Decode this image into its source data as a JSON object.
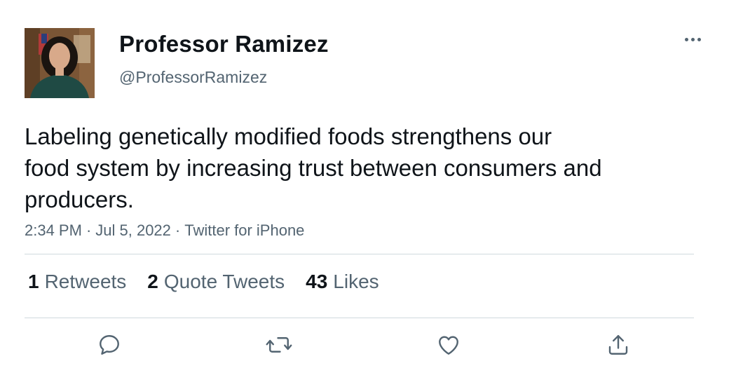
{
  "author": {
    "display_name": "Professor Ramizez",
    "handle": "@ProfessorRamizez",
    "avatar_icon": "profile-photo"
  },
  "tweet": {
    "lines": [
      "Labeling genetically modified foods strengthens our",
      "food system by increasing trust between consumers and",
      "producers."
    ],
    "time": "2:34 PM",
    "date": "Jul 5, 2022",
    "separator": "·",
    "source": "Twitter for iPhone"
  },
  "stats": {
    "retweets": {
      "count": "1",
      "label": "Retweets"
    },
    "quote_tweets": {
      "count": "2",
      "label": "Quote Tweets"
    },
    "likes": {
      "count": "43",
      "label": "Likes"
    }
  },
  "actions": [
    "reply-icon",
    "retweet-icon",
    "like-icon",
    "share-icon"
  ],
  "colors": {
    "text": "#0f1419",
    "secondary": "#536471",
    "divider": "#cfd9de",
    "background": "#ffffff"
  }
}
